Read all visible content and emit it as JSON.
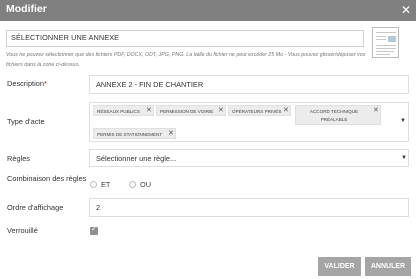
{
  "dialog": {
    "title": "Modifier",
    "close_glyph": "✕",
    "select_annex_label": "SÉLECTIONNER UNE ANNEXE",
    "hint_text": "Vous ne pouvez sélectionner que des fichiers PDF, DOCX, ODT, JPG, PNG. La taille du fichier ne peut excéder 25 Mo - Vous pouvez glisser/déposer vos fichiers dans la zone ci-dessus."
  },
  "form": {
    "description_label": "Description",
    "description_required_mark": "*",
    "description_value": "ANNEXE 2 - FIN DE CHANTIER",
    "type_label": "Type d'acte",
    "type_chips": [
      "RÉSEAUX PUBLICS",
      "PERMISSION DE VOIRIE",
      "OPÉRATEURS PRIVÉS",
      "ACCORD TECHNIQUE PRÉALABLE",
      "PERMIS DE STATIONNEMENT"
    ],
    "chip_remove_glyph": "✕",
    "rules_label": "Règles",
    "rules_placeholder": "Sélectionner une règle...",
    "combination_label": "Combinaison des règles",
    "combination_options": [
      "ET",
      "OU"
    ],
    "combination_selected": "ET",
    "order_label": "Ordre d'affichage",
    "order_value": "2",
    "locked_label": "Verrouillé",
    "locked_checked": true,
    "check_glyph": "✓",
    "dropdown_glyph": "▼"
  },
  "buttons": {
    "validate": "VALIDER",
    "cancel": "ANNULER"
  },
  "colors": {
    "titlebar": "#808080",
    "button": "#a5a5a5",
    "chip": "#ececec",
    "required": "#cc0000"
  },
  "icons": [
    "close-icon",
    "document-thumbnail-icon",
    "chip-remove-icon",
    "dropdown-caret-icon",
    "check-icon"
  ]
}
